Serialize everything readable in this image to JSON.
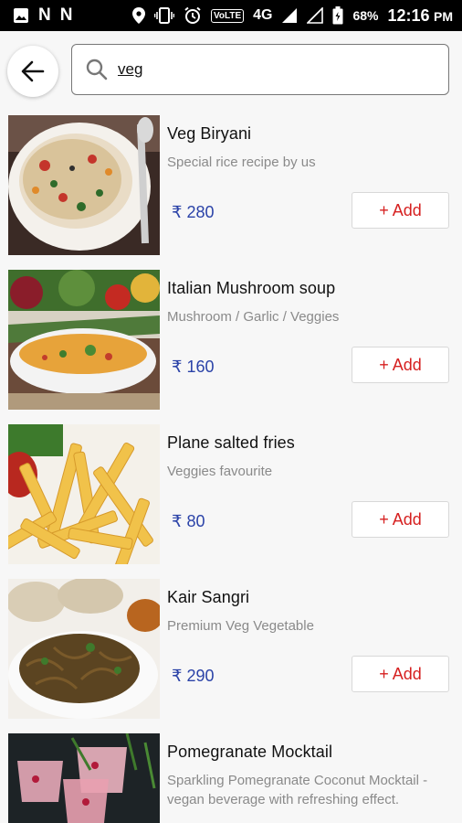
{
  "status_bar": {
    "battery": "68%",
    "time": "12:16",
    "meridiem": "PM",
    "network": "4G",
    "volte": "VoLTE"
  },
  "search": {
    "query": "veg",
    "placeholder": ""
  },
  "currency": "₹",
  "add_label": "+ Add",
  "items": [
    {
      "title": "Veg Biryani",
      "description": "Special rice recipe by us",
      "price": "₹ 280",
      "image": "veg-biryani-image"
    },
    {
      "title": "Italian Mushroom soup",
      "description": "Mushroom / Garlic / Veggies",
      "price": "₹ 160",
      "image": "mushroom-soup-image"
    },
    {
      "title": "Plane salted fries",
      "description": "Veggies favourite",
      "price": "₹ 80",
      "image": "fries-image"
    },
    {
      "title": "Kair Sangri",
      "description": "Premium Veg Vegetable",
      "price": "₹ 290",
      "image": "kair-sangri-image"
    },
    {
      "title": "Pomegranate Mocktail",
      "description": "Sparkling Pomegranate Coconut Mocktail - vegan beverage with refreshing effect.",
      "price": "",
      "image": "mocktail-image"
    }
  ],
  "colors": {
    "price": "#2b43a8",
    "add": "#d62020",
    "background": "#f7f7f7"
  }
}
